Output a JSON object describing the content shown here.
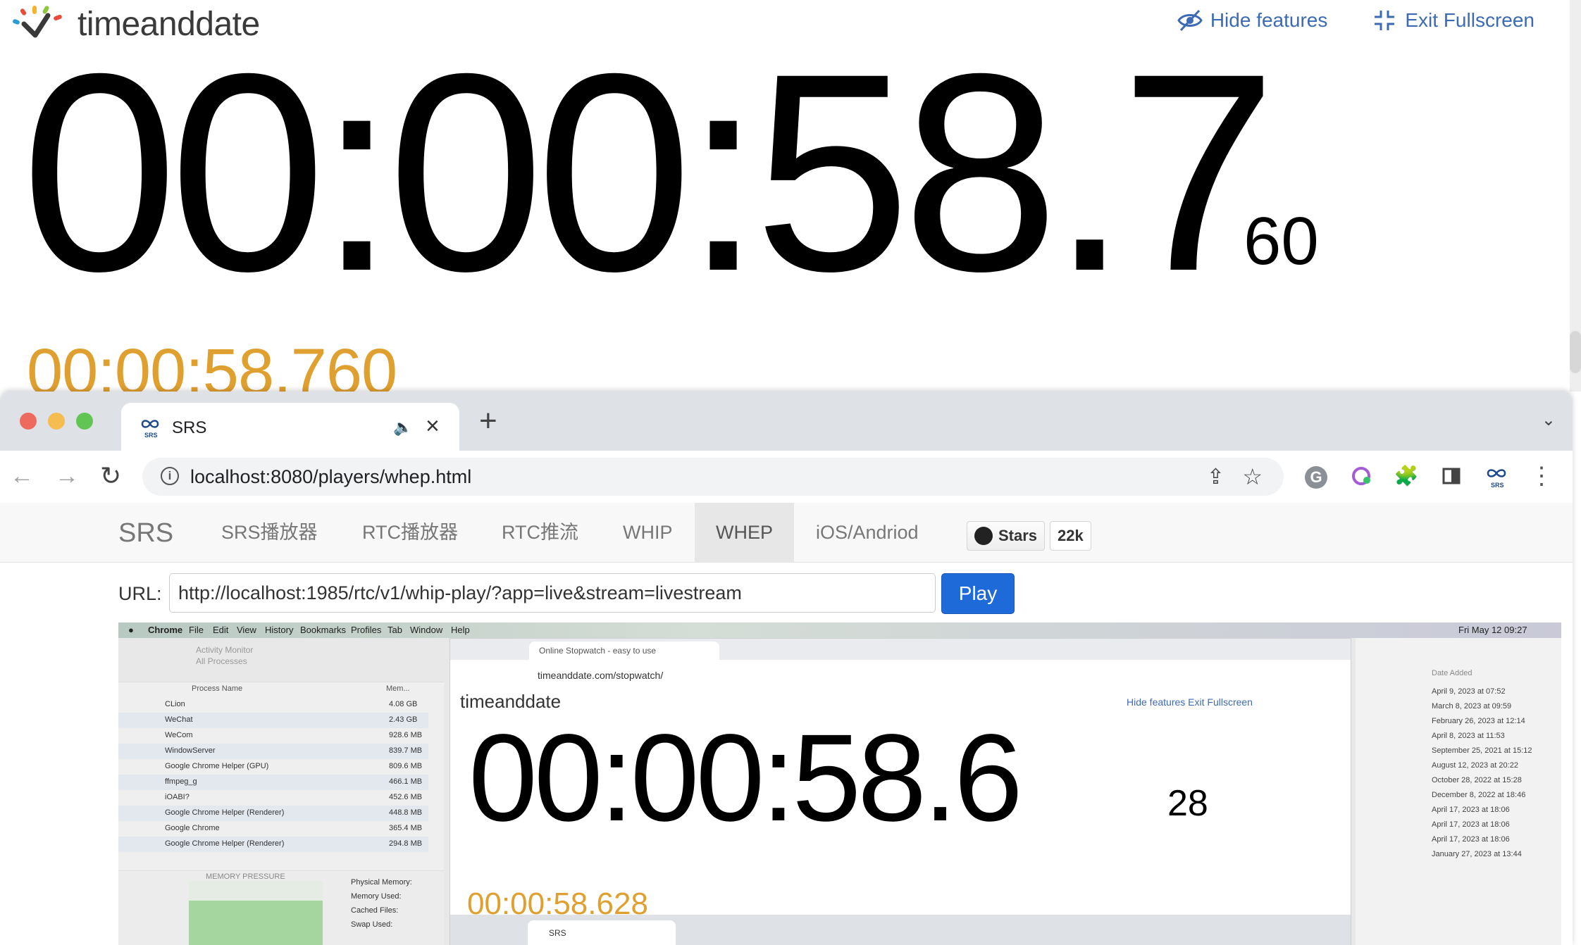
{
  "tad": {
    "logo_text": "timeanddate",
    "hide_features_label": "Hide features",
    "exit_fullscreen_label": "Exit Fullscreen",
    "stopwatch_main": "00:00:58.7",
    "stopwatch_ms": "60",
    "stopwatch_lap": "00:00:58.760"
  },
  "browser": {
    "tab_title": "SRS",
    "new_tab_symbol": "+",
    "url": "localhost:8080/players/whep.html"
  },
  "srs": {
    "brand": "SRS",
    "nav": [
      {
        "label": "SRS播放器"
      },
      {
        "label": "RTC播放器"
      },
      {
        "label": "RTC推流"
      },
      {
        "label": "WHIP"
      },
      {
        "label": "WHEP",
        "active": true
      },
      {
        "label": "iOS/Andriod"
      }
    ],
    "github_stars_label": "Stars",
    "github_stars_count": "22k",
    "url_label": "URL:",
    "url_value": "http://localhost:1985/rtc/v1/whip-play/?app=live&stream=livestream",
    "play_label": "Play"
  },
  "video": {
    "menubar": [
      "Chrome",
      "File",
      "Edit",
      "View",
      "History",
      "Bookmarks",
      "Profiles",
      "Tab",
      "Window",
      "Help"
    ],
    "menubar_clock": "Fri May 12 09:27",
    "activity_title": "Activity Monitor",
    "activity_subtitle": "All Processes",
    "col_process": "Process Name",
    "col_memory": "Mem...",
    "processes": [
      {
        "name": "CLion",
        "mem": "4.08 GB"
      },
      {
        "name": "WeChat",
        "mem": "2.43 GB"
      },
      {
        "name": "WeCom",
        "mem": "928.6 MB"
      },
      {
        "name": "WindowServer",
        "mem": "839.7 MB"
      },
      {
        "name": "Google Chrome Helper (GPU)",
        "mem": "809.6 MB"
      },
      {
        "name": "ffmpeg_g",
        "mem": "466.1 MB"
      },
      {
        "name": "iOABI?",
        "mem": "452.6 MB"
      },
      {
        "name": "Google Chrome Helper (Renderer)",
        "mem": "448.8 MB"
      },
      {
        "name": "Google Chrome",
        "mem": "365.4 MB"
      },
      {
        "name": "Google Chrome Helper (Renderer)",
        "mem": "294.8 MB"
      }
    ],
    "memory_pressure": "MEMORY PRESSURE",
    "memory_labels": [
      "Physical Memory:",
      "Memory Used:",
      "Cached Files:",
      "Swap Used:"
    ],
    "inner_tab_title": "Online Stopwatch - easy to use",
    "inner_url": "timeanddate.com/stopwatch/",
    "inner_logo": "timeanddate",
    "inner_actions": "Hide features   Exit Fullscreen",
    "inner_time": "00:00:58.6",
    "inner_ms": "28",
    "inner_lap": "00:00:58.628",
    "nested_tab_title": "SRS",
    "right_header": "Date Added",
    "right_dates": [
      "April 9, 2023 at 07:52",
      "March 8, 2023 at 09:59",
      "February 26, 2023 at 12:14",
      "April 8, 2023 at 11:53",
      "September 25, 2021 at 15:12",
      "August 12, 2023 at 20:22",
      "October 28, 2022 at 15:28",
      "December 8, 2022 at 18:46",
      "April 17, 2023 at 18:06",
      "April 17, 2023 at 18:06",
      "April 17, 2023 at 18:06",
      "January 27, 2023 at 13:44"
    ]
  },
  "colors": {
    "accent_blue": "#3d6bb3",
    "lap_orange": "#e0a030",
    "play_blue": "#1f6ad9"
  }
}
